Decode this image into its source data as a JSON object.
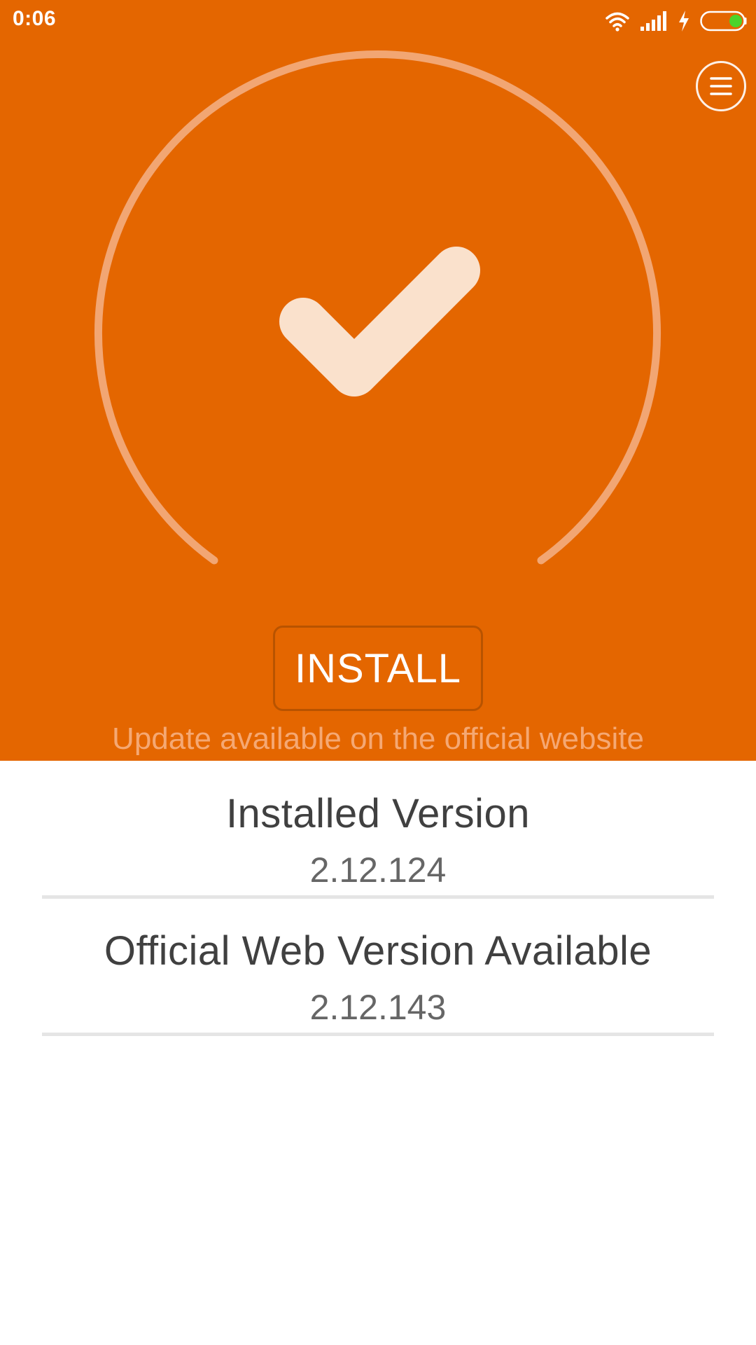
{
  "status_bar": {
    "time": "0:06",
    "icons": [
      "wifi-icon",
      "signal-icon",
      "charging-icon",
      "battery-icon"
    ],
    "battery_color": "#4CD32B"
  },
  "colors": {
    "primary": "#E46600",
    "ring": "#F2A673",
    "check": "#FAE1CC",
    "subtle_text": "#F5A873"
  },
  "header": {
    "menu_icon": "hamburger-menu-icon"
  },
  "status_graphic": {
    "icon": "checkmark-icon"
  },
  "install_button": {
    "label": "INSTALL"
  },
  "update_message": "Update available on the official website",
  "versions": {
    "installed": {
      "label": "Installed Version",
      "value": "2.12.124"
    },
    "official": {
      "label": "Official Web Version Available",
      "value": "2.12.143"
    }
  }
}
